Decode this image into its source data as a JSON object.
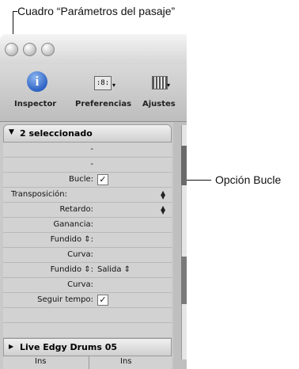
{
  "callouts": {
    "top": "Cuadro “Parámetros del pasaje”",
    "right": "Opción Bucle"
  },
  "toolbar": {
    "inspector": "Inspector",
    "preferences": "Preferencias",
    "settings": "Ajustes"
  },
  "region_params": {
    "header": "2 seleccionado",
    "dash1": "-",
    "dash2": "-",
    "loop": "Bucle:",
    "transpose": "Transposición:",
    "delay": "Retardo:",
    "gain": "Ganancia:",
    "fade1": "Fundido ⇕:",
    "curve1": "Curva:",
    "fade2": "Fundido ⇕:",
    "fade2_value": "Salida ⇕",
    "curve2": "Curva:",
    "follow_tempo": "Seguir tempo:"
  },
  "track": {
    "name": "Live Edgy Drums 05",
    "col1": "Ins",
    "col2": "Ins"
  }
}
